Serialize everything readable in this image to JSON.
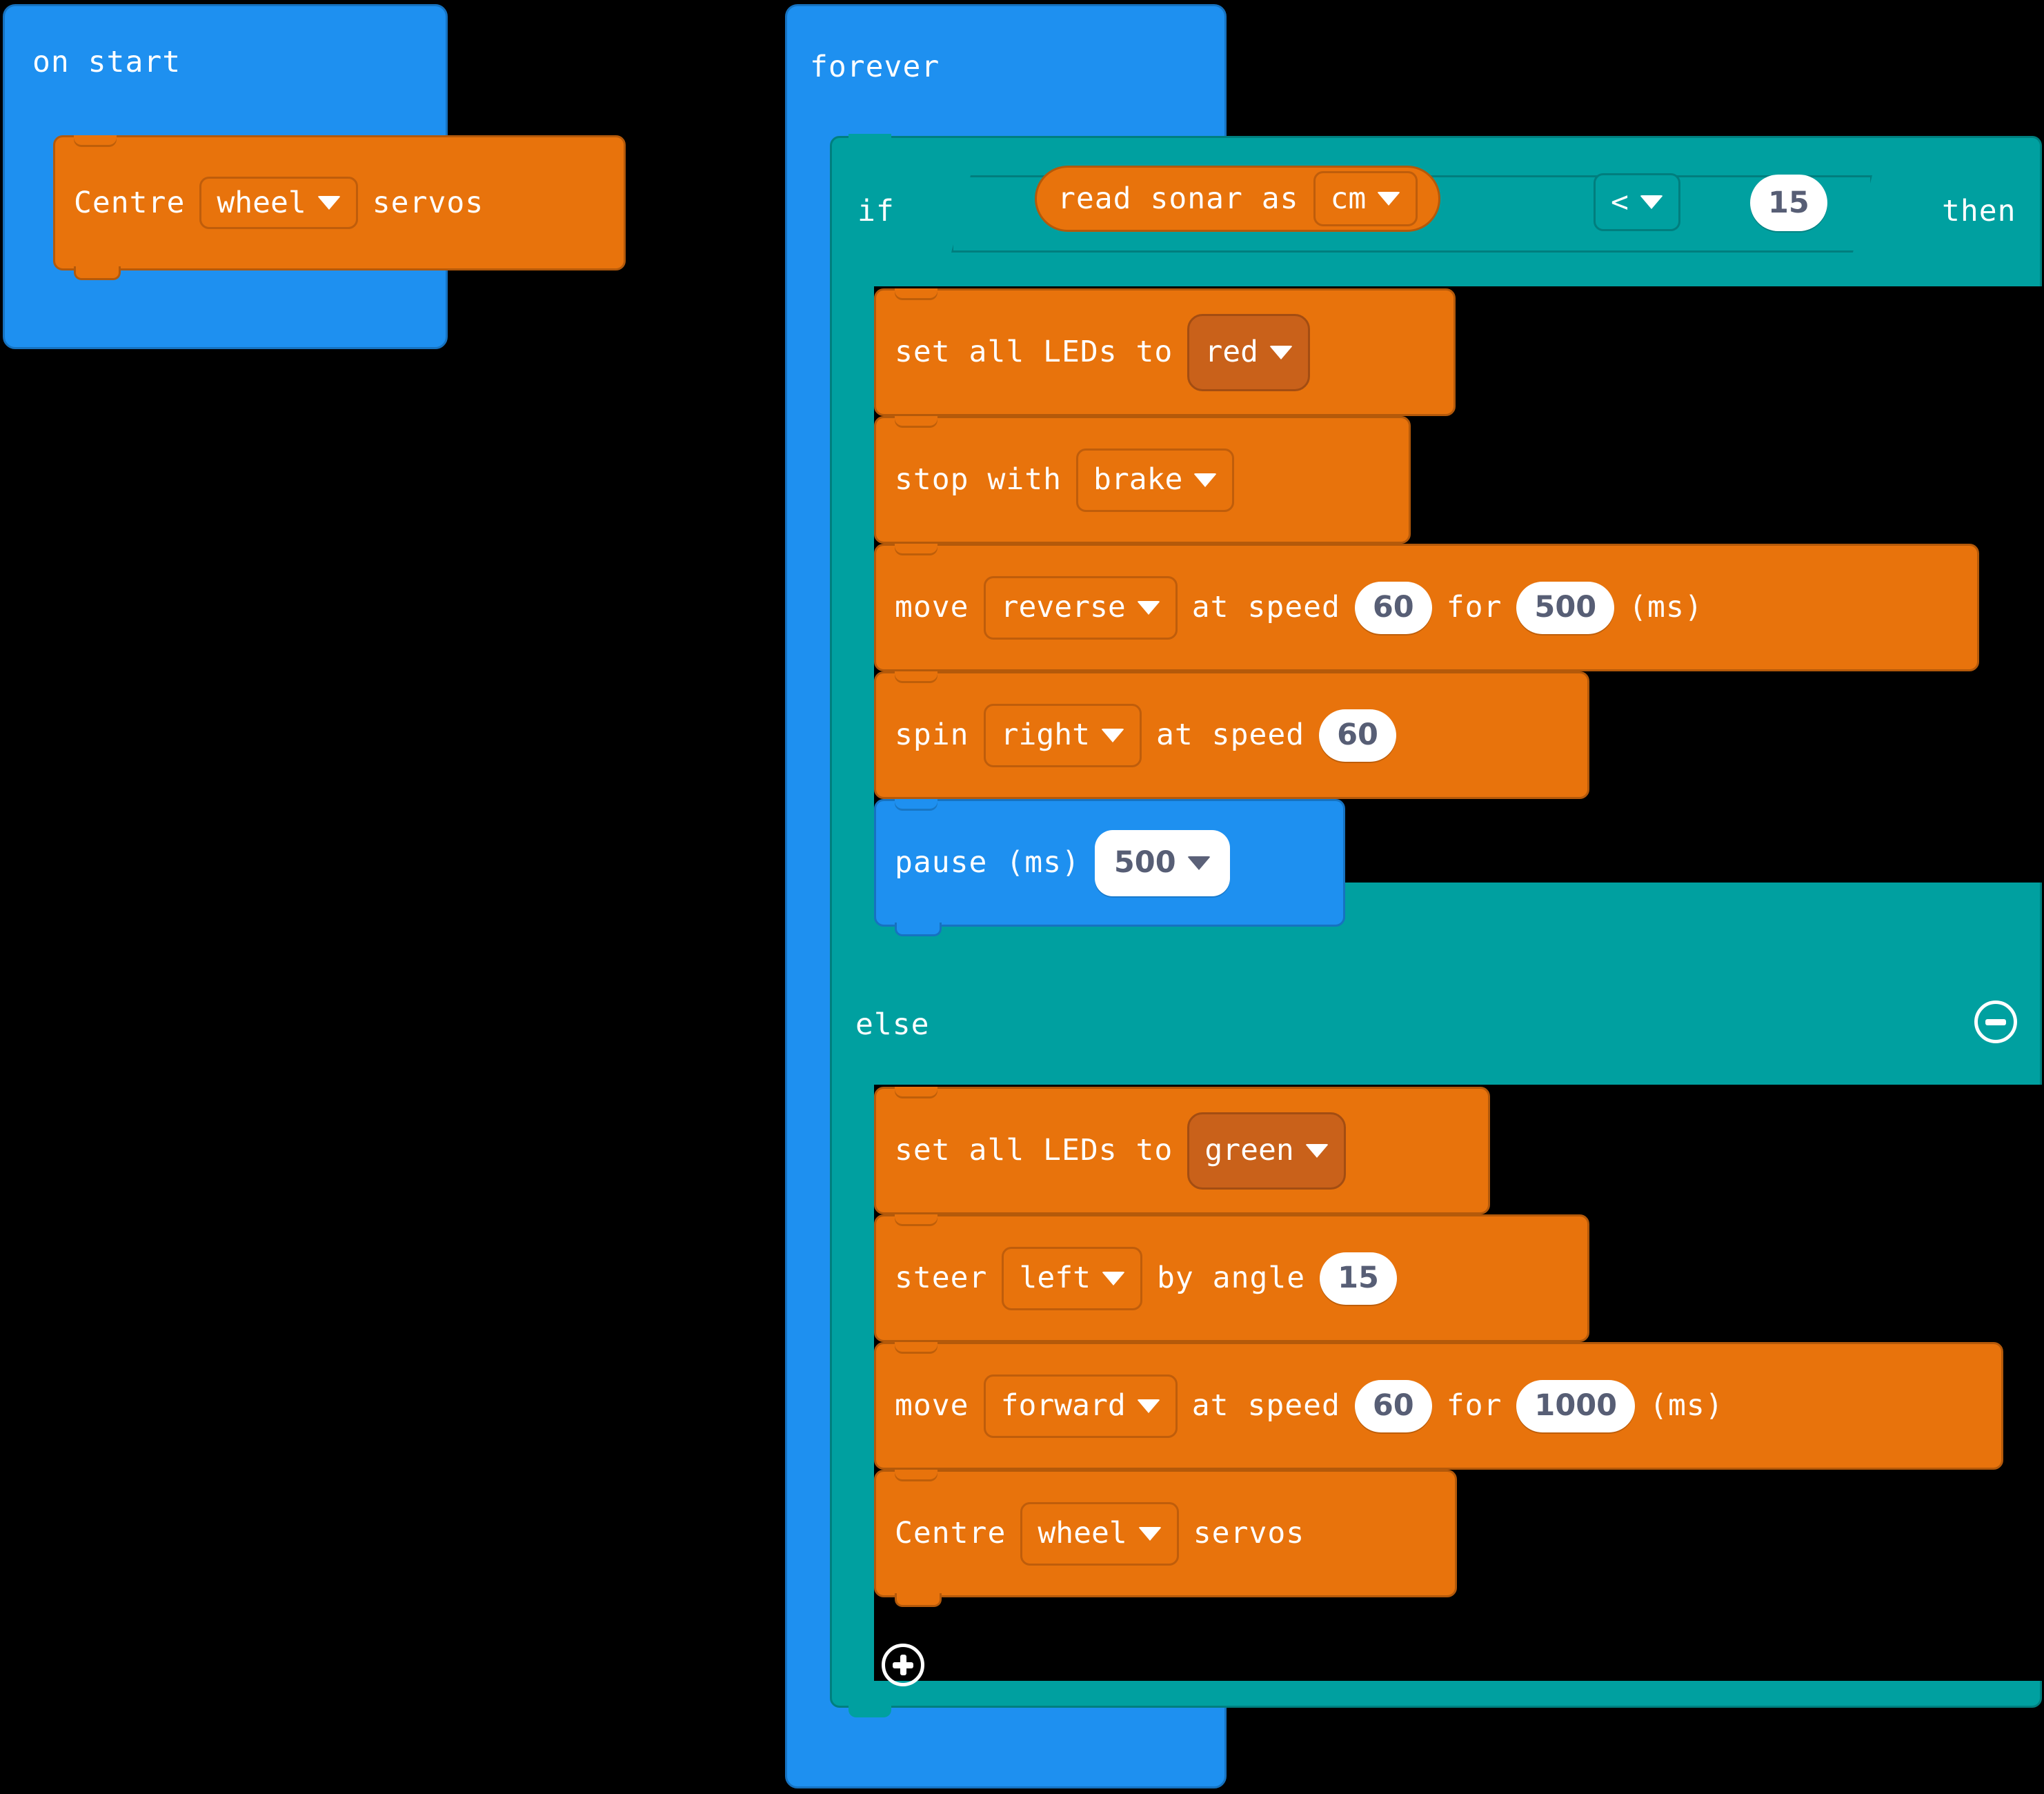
{
  "workspace": {
    "background": "#000000",
    "colors": {
      "event_blue": "#1E90F0",
      "logic_teal": "#00A0A0",
      "robot_orange": "#E8730C",
      "dropdown_dark_orange": "#C9611A",
      "number_text": "#575E75"
    }
  },
  "scripts": {
    "on_start": {
      "header": "on start",
      "body": [
        {
          "id": "centre-servos-1",
          "kind": "statement",
          "color": "orange",
          "parts": [
            {
              "type": "label",
              "text": "Centre"
            },
            {
              "type": "dropdown",
              "value": "wheel",
              "icon": "chevron-down-icon"
            },
            {
              "type": "label",
              "text": "servos"
            }
          ]
        }
      ]
    },
    "forever": {
      "header": "forever",
      "if_else": {
        "if_label": "if",
        "then_label": "then",
        "else_label": "else",
        "collapse_icon": "minus-circle-icon",
        "expand_icon": "plus-circle-icon",
        "condition": {
          "left": {
            "kind": "reporter",
            "color": "orange",
            "label": "read sonar as",
            "unit": "cm",
            "unit_icon": "chevron-down-icon"
          },
          "operator": {
            "value": "<",
            "icon": "chevron-down-icon"
          },
          "right": {
            "value": "15"
          }
        },
        "then_body": [
          {
            "id": "set-leds-red",
            "kind": "statement",
            "color": "orange",
            "parts": [
              {
                "type": "label",
                "text": "set all LEDs to"
              },
              {
                "type": "dropdown-dark",
                "value": "red",
                "icon": "chevron-down-icon"
              }
            ]
          },
          {
            "id": "stop-brake",
            "kind": "statement",
            "color": "orange",
            "parts": [
              {
                "type": "label",
                "text": "stop with"
              },
              {
                "type": "dropdown",
                "value": "brake",
                "icon": "chevron-down-icon"
              }
            ]
          },
          {
            "id": "move-reverse",
            "kind": "statement",
            "color": "orange",
            "parts": [
              {
                "type": "label",
                "text": "move"
              },
              {
                "type": "dropdown",
                "value": "reverse",
                "icon": "chevron-down-icon"
              },
              {
                "type": "label",
                "text": "at speed"
              },
              {
                "type": "number",
                "value": "60"
              },
              {
                "type": "label",
                "text": "for"
              },
              {
                "type": "number",
                "value": "500"
              },
              {
                "type": "label",
                "text": "(ms)"
              }
            ]
          },
          {
            "id": "spin-right",
            "kind": "statement",
            "color": "orange",
            "parts": [
              {
                "type": "label",
                "text": "spin"
              },
              {
                "type": "dropdown",
                "value": "right",
                "icon": "chevron-down-icon"
              },
              {
                "type": "label",
                "text": "at speed"
              },
              {
                "type": "number",
                "value": "60"
              }
            ]
          },
          {
            "id": "pause-500",
            "kind": "statement",
            "color": "blue",
            "parts": [
              {
                "type": "label",
                "text": "pause (ms)"
              },
              {
                "type": "number-dropdown",
                "value": "500",
                "icon": "chevron-down-icon"
              }
            ]
          }
        ],
        "else_body": [
          {
            "id": "set-leds-green",
            "kind": "statement",
            "color": "orange",
            "parts": [
              {
                "type": "label",
                "text": "set all LEDs to"
              },
              {
                "type": "dropdown-dark",
                "value": "green",
                "icon": "chevron-down-icon"
              }
            ]
          },
          {
            "id": "steer-left",
            "kind": "statement",
            "color": "orange",
            "parts": [
              {
                "type": "label",
                "text": "steer"
              },
              {
                "type": "dropdown",
                "value": "left",
                "icon": "chevron-down-icon"
              },
              {
                "type": "label",
                "text": "by angle"
              },
              {
                "type": "number",
                "value": "15"
              }
            ]
          },
          {
            "id": "move-forward",
            "kind": "statement",
            "color": "orange",
            "parts": [
              {
                "type": "label",
                "text": "move"
              },
              {
                "type": "dropdown",
                "value": "forward",
                "icon": "chevron-down-icon"
              },
              {
                "type": "label",
                "text": "at speed"
              },
              {
                "type": "number",
                "value": "60"
              },
              {
                "type": "label",
                "text": "for"
              },
              {
                "type": "number",
                "value": "1000"
              },
              {
                "type": "label",
                "text": "(ms)"
              }
            ]
          },
          {
            "id": "centre-servos-2",
            "kind": "statement",
            "color": "orange",
            "parts": [
              {
                "type": "label",
                "text": "Centre"
              },
              {
                "type": "dropdown",
                "value": "wheel",
                "icon": "chevron-down-icon"
              },
              {
                "type": "label",
                "text": "servos"
              }
            ]
          }
        ]
      }
    }
  },
  "text": {
    "on_start": "on start",
    "forever": "forever",
    "if": "if",
    "then": "then",
    "else": "else",
    "centre": "Centre",
    "servos": "servos",
    "wheel": "wheel",
    "read_sonar_as": "read sonar as",
    "cm": "cm",
    "op_lt": "<",
    "fifteen": "15",
    "set_all_leds_to": "set all LEDs to",
    "red": "red",
    "green": "green",
    "stop_with": "stop with",
    "brake": "brake",
    "move": "move",
    "reverse": "reverse",
    "forward": "forward",
    "at_speed": "at speed",
    "sixty": "60",
    "for": "for",
    "five_hundred": "500",
    "one_thousand": "1000",
    "ms": "(ms)",
    "spin": "spin",
    "right": "right",
    "pause_ms": "pause (ms)",
    "pause_value": "500",
    "steer": "steer",
    "left": "left",
    "by_angle": "by angle",
    "angle_value": "15"
  }
}
